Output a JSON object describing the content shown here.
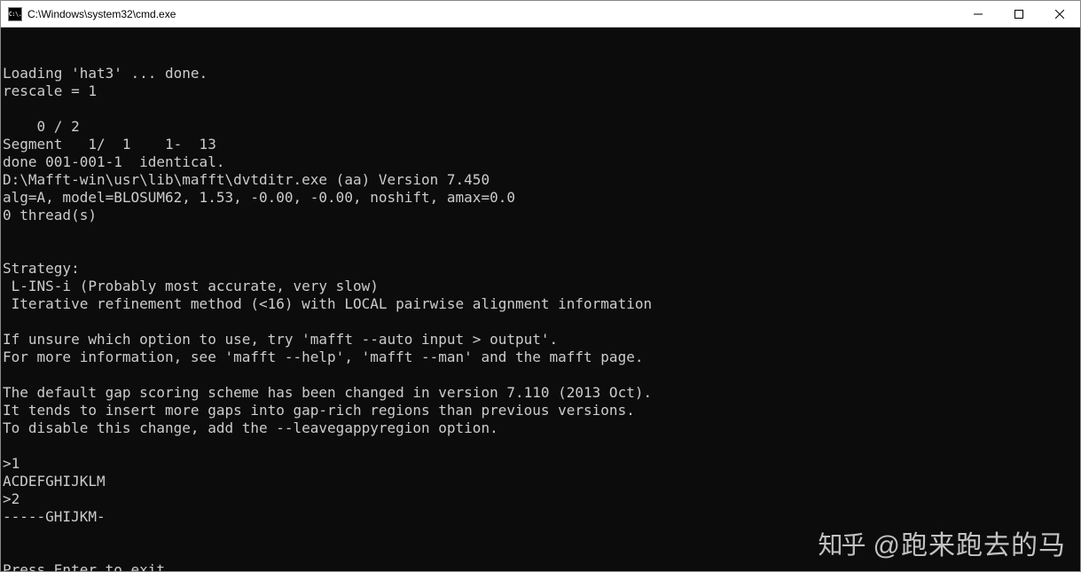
{
  "titlebar": {
    "icon_text": "C:\\.",
    "title": "C:\\Windows\\system32\\cmd.exe"
  },
  "terminal": {
    "lines": [
      "Loading 'hat3' ... done.",
      "rescale = 1",
      "",
      "    0 / 2",
      "Segment   1/  1    1-  13",
      "done 001-001-1  identical.",
      "D:\\Mafft-win\\usr\\lib\\mafft\\dvtditr.exe (aa) Version 7.450",
      "alg=A, model=BLOSUM62, 1.53, -0.00, -0.00, noshift, amax=0.0",
      "0 thread(s)",
      "",
      "",
      "Strategy:",
      " L-INS-i (Probably most accurate, very slow)",
      " Iterative refinement method (<16) with LOCAL pairwise alignment information",
      "",
      "If unsure which option to use, try 'mafft --auto input > output'.",
      "For more information, see 'mafft --help', 'mafft --man' and the mafft page.",
      "",
      "The default gap scoring scheme has been changed in version 7.110 (2013 Oct).",
      "It tends to insert more gaps into gap-rich regions than previous versions.",
      "To disable this change, add the --leavegappyregion option.",
      "",
      ">1",
      "ACDEFGHIJKLM",
      ">2",
      "-----GHIJKM-"
    ],
    "prompt_line": "Press Enter to exit."
  },
  "watermark": {
    "logo": "知乎",
    "text": "@跑来跑去的马"
  }
}
